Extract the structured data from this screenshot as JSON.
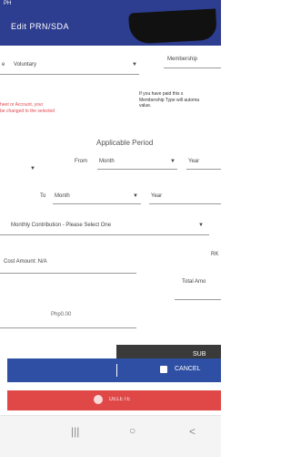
{
  "status_bar": {
    "time": "PH"
  },
  "app_bar": {
    "title": "Edit PRN/SDA",
    "title_suffix": ""
  },
  "form": {
    "membership_label": "Membership",
    "membership_value": "Voluntary",
    "info_left_line1": "heet or Account, your",
    "info_left_line2": "be changed to the selected",
    "info_right_line1": "If you have paid this s",
    "info_right_line2": "Membership Type will automa",
    "info_right_line3": "value.",
    "applicable_period_title": "Applicable Period",
    "from_label": "From",
    "from_month": "Month",
    "from_year": "Year",
    "to_label": "To",
    "to_month": "Month",
    "to_year": "Year",
    "monthly_contribution": "Monthly Contribution - Please Select One",
    "rk_label": "RK",
    "cost_amount": "Cost Amount: N/A",
    "total_amount_label": "Total Amo",
    "total_amount_value": "Php0.00"
  },
  "buttons": {
    "submit_label": "SUB",
    "cancel_label": "CANCEL",
    "delete_label": "DELETE"
  },
  "navbar": {
    "recents_icon": "|||",
    "home_icon": "○",
    "back_icon": "<"
  },
  "colors": {
    "app_bar": "#2d3d8f",
    "primary_button": "#2e4fa3",
    "danger_button": "#e04848",
    "accent_text": "#e0474c"
  }
}
